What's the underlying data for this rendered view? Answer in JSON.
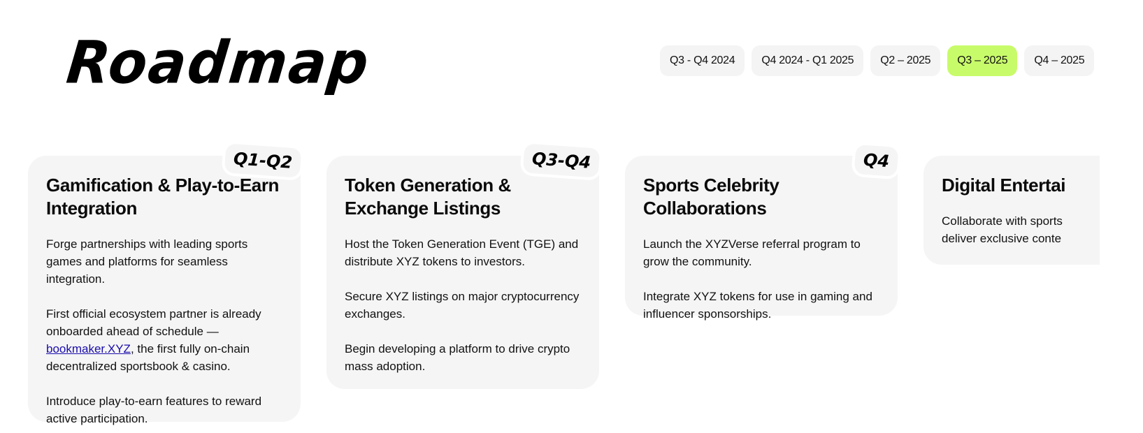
{
  "page": {
    "title": "Roadmap"
  },
  "tabs": [
    {
      "label": "Q3 - Q4 2024",
      "active": false
    },
    {
      "label": "Q4 2024 - Q1 2025",
      "active": false
    },
    {
      "label": "Q2 – 2025",
      "active": false
    },
    {
      "label": "Q3 – 2025",
      "active": true
    },
    {
      "label": "Q4 – 2025",
      "active": false
    }
  ],
  "colors": {
    "active_tab": "#c8fb6a",
    "card_bg": "#f5f5f5",
    "link": "#1a0dab"
  },
  "cards": [
    {
      "badge": "Q1-Q2",
      "title": "Gamification & Play-to-Earn Integration",
      "paragraphs": [
        "Forge partnerships with leading sports games and platforms for seamless integration.",
        {
          "before": "First official ecosystem partner is already onboarded ahead of schedule — ",
          "link": "bookmaker.XYZ",
          "after": ", the first fully on-chain decentralized sportsbook & casino."
        },
        "Introduce play-to-earn features to reward active participation."
      ]
    },
    {
      "badge": "Q3-Q4",
      "title": "Token Generation & Exchange Listings",
      "paragraphs": [
        "Host the Token Generation Event (TGE) and distribute XYZ tokens to investors.",
        "Secure XYZ listings on major cryptocurrency exchanges.",
        "Begin developing a platform to drive crypto mass adoption."
      ]
    },
    {
      "badge": "Q4",
      "title": "Sports Celebrity Collaborations",
      "paragraphs": [
        "Launch the XYZVerse referral program to grow the community.",
        "Integrate XYZ tokens for use in gaming and influencer sponsorships."
      ]
    },
    {
      "badge": "",
      "title": "Digital Entertai",
      "paragraphs": [
        "Collaborate with sports deliver exclusive conte"
      ]
    }
  ]
}
